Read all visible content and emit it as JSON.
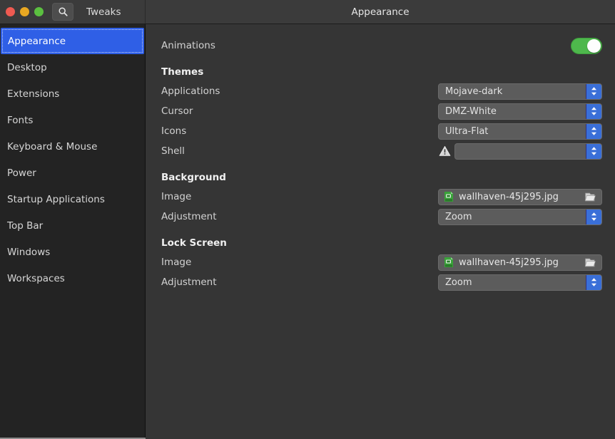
{
  "titlebar": {
    "app_name": "Tweaks",
    "page_title": "Appearance",
    "search_icon": "search-icon",
    "window_buttons": [
      {
        "name": "close",
        "color": "#ef5a51"
      },
      {
        "name": "minimize",
        "color": "#e9a822"
      },
      {
        "name": "maximize",
        "color": "#5bc040"
      }
    ]
  },
  "sidebar": {
    "selected": "Appearance",
    "items": [
      {
        "label": "Appearance"
      },
      {
        "label": "Desktop"
      },
      {
        "label": "Extensions"
      },
      {
        "label": "Fonts"
      },
      {
        "label": "Keyboard & Mouse"
      },
      {
        "label": "Power"
      },
      {
        "label": "Startup Applications"
      },
      {
        "label": "Top Bar"
      },
      {
        "label": "Windows"
      },
      {
        "label": "Workspaces"
      }
    ]
  },
  "content": {
    "animations": {
      "label": "Animations",
      "switch_state": "on",
      "switch_color": "#4eb84c"
    },
    "themes": {
      "heading": "Themes",
      "applications": {
        "label": "Applications",
        "value": "Mojave-dark"
      },
      "cursor": {
        "label": "Cursor",
        "value": "DMZ-White"
      },
      "icons": {
        "label": "Icons",
        "value": "Ultra-Flat"
      },
      "shell": {
        "label": "Shell",
        "value": "",
        "warning_icon": "warning-icon"
      }
    },
    "background": {
      "heading": "Background",
      "image": {
        "label": "Image",
        "value": "wallhaven-45j295.jpg",
        "file_icon": "jpg-file-icon",
        "open_icon": "open-folder-icon"
      },
      "adjustment": {
        "label": "Adjustment",
        "value": "Zoom"
      }
    },
    "lock_screen": {
      "heading": "Lock Screen",
      "image": {
        "label": "Image",
        "value": "wallhaven-45j295.jpg",
        "file_icon": "jpg-file-icon",
        "open_icon": "open-folder-icon"
      },
      "adjustment": {
        "label": "Adjustment",
        "value": "Zoom"
      }
    }
  },
  "colors": {
    "accent_blue": "#2f5fe6",
    "combo_arrow_blue": "#3a6fd8",
    "sidebar_bg": "#232323",
    "content_bg": "#353535",
    "titlebar_bg": "#3b3b3b"
  }
}
